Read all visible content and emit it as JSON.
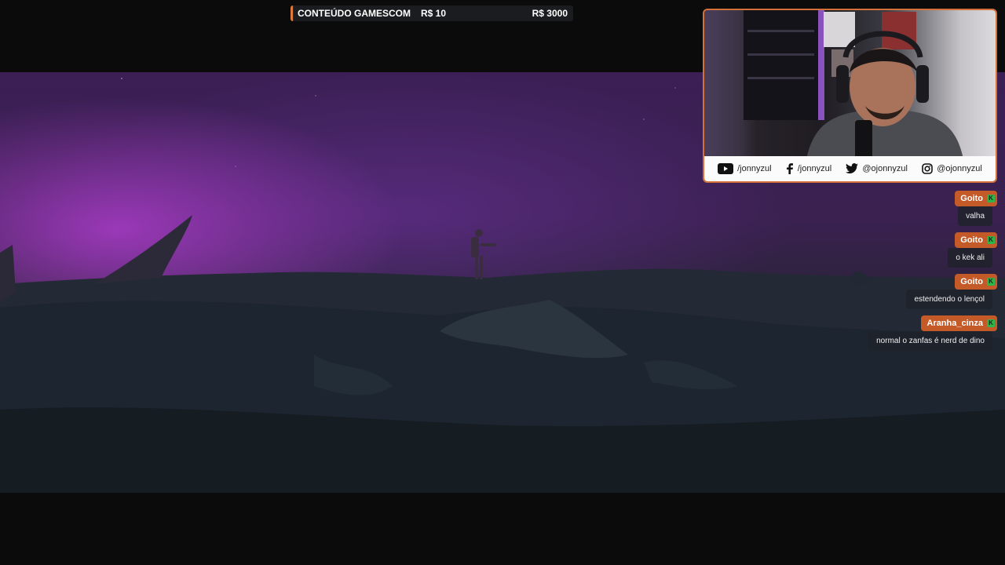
{
  "goal": {
    "title": "CONTEÚDO GAMESCOM",
    "current": "R$ 10",
    "target": "R$ 3000",
    "progress_fraction": 0.0033,
    "accent": "#e07a3c"
  },
  "webcam": {
    "border_color": "#d4713a",
    "socials": [
      {
        "icon": "youtube-icon",
        "handle": "/jonnyzul"
      },
      {
        "icon": "facebook-icon",
        "handle": "/jonnyzul"
      },
      {
        "icon": "twitter-icon",
        "handle": "@ojonnyzul"
      },
      {
        "icon": "instagram-icon",
        "handle": "@ojonnyzul"
      }
    ]
  },
  "chat": {
    "name_color": "#c45a27",
    "badge_color": "#2db44a",
    "messages": [
      {
        "user": "Goito",
        "text": "valha"
      },
      {
        "user": "Goito",
        "text": "o kek ali"
      },
      {
        "user": "Goito",
        "text": "estendendo o lençol"
      },
      {
        "user": "Aranha_cinza",
        "text": "normal o zanfas é nerd de dino"
      }
    ]
  }
}
